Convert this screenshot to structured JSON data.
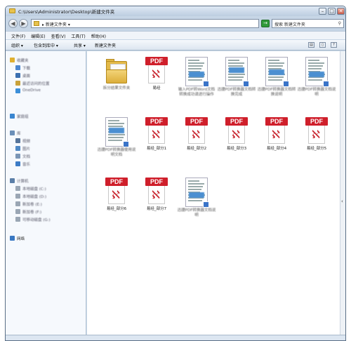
{
  "title": "C:\\Users\\Administrator\\Desktop\\新建文件夹",
  "address": {
    "crumb": "▸ 新建文件夹 ▾"
  },
  "search": {
    "placeholder": "搜索 新建文件夹"
  },
  "window_buttons": {
    "minimize": "–",
    "maximize": "□",
    "close": "✕"
  },
  "nav": {
    "back": "◀",
    "forward": "▶",
    "refresh": "→"
  },
  "menu": [
    "文件(F)",
    "编辑(E)",
    "查看(V)",
    "工具(T)",
    "帮助(H)"
  ],
  "toolbar": {
    "organize": "组织 ▾",
    "include": "包含到库中 ▾",
    "share": "共享 ▾",
    "new_folder": "新建文件夹"
  },
  "sidebar": {
    "favorites": [
      "收藏夹",
      "下载",
      "桌面",
      "最近访问的位置",
      "OneDrive"
    ],
    "homegroup": "家庭组",
    "libraries": [
      "库",
      "视频",
      "图片",
      "文档",
      "音乐"
    ],
    "computer": [
      "计算机",
      "本地磁盘 (C:)",
      "本地磁盘 (D:)",
      "新加卷 (E:)",
      "新加卷 (F:)",
      "可移动磁盘 (G:)"
    ],
    "network": "网络"
  },
  "files": [
    {
      "type": "folder",
      "name": "拆分结果文件夹"
    },
    {
      "type": "pdf",
      "name": "易经"
    },
    {
      "type": "doc",
      "name": "输入PDF转Word文档转换成功请进行操作"
    },
    {
      "type": "doc",
      "name": "迅捷PDF转换器文档转换完成"
    },
    {
      "type": "doc",
      "name": "迅捷PDF转换器文档转换说明"
    },
    {
      "type": "doc",
      "name": "迅捷PDF转换器文档说明"
    },
    {
      "type": "doc",
      "name": "迅捷PDF转换器使用说明文档"
    },
    {
      "type": "pdf",
      "name": "易经_部分1"
    },
    {
      "type": "pdf",
      "name": "易经_部分2"
    },
    {
      "type": "pdf",
      "name": "易经_部分3"
    },
    {
      "type": "pdf",
      "name": "易经_部分4"
    },
    {
      "type": "pdf",
      "name": "易经_部分5"
    },
    {
      "type": "pdf",
      "name": "易经_部分6"
    },
    {
      "type": "pdf",
      "name": "易经_部分7"
    },
    {
      "type": "doc",
      "name": "迅捷PDF转换器文档说明"
    }
  ]
}
